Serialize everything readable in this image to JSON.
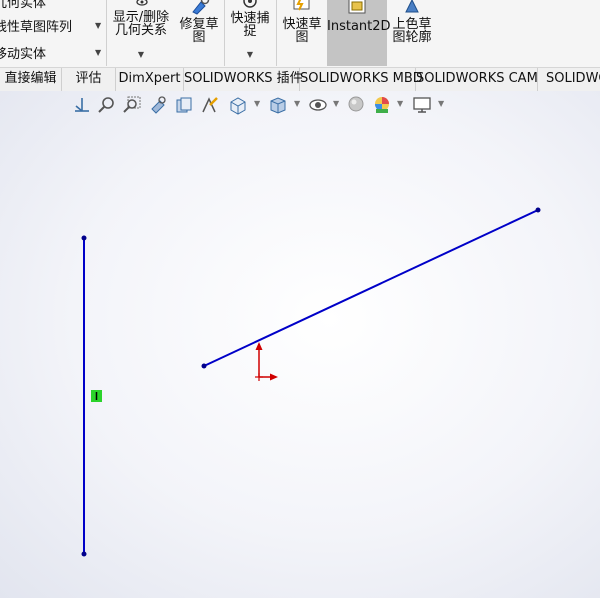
{
  "ribbon": {
    "list_items": [
      {
        "label": "线性草图阵列"
      },
      {
        "label": "移动实体"
      }
    ],
    "top_partial": "几何实体",
    "buttons": {
      "display_delete": {
        "line1": "显示/删除",
        "line2": "几何关系"
      },
      "repair": {
        "line1": "修复草",
        "line2": "图"
      },
      "quick_snap": {
        "line1": "快速捕",
        "line2": "捉"
      },
      "quick_sketch": {
        "line1": "快速草",
        "line2": "图"
      },
      "instant2d": {
        "line1": "Instant2D"
      },
      "shaded_sketch": {
        "line1": "上色草",
        "line2": "图轮廓"
      }
    }
  },
  "tabs": [
    "直接编辑",
    "评估",
    "DimXpert",
    "SOLIDWORKS 插件",
    "SOLIDWORKS MBD",
    "SOLIDWORKS CAM",
    "SOLIDWO"
  ],
  "heads_up_toolbar": {
    "icons": [
      "view-orientation-icon",
      "zoom-to-fit-icon",
      "zoom-to-area-icon",
      "previous-view-icon",
      "section-view-icon",
      "dynamic-annotation-icon",
      "view-orientation-cube-icon",
      "display-style-icon",
      "hide-show-items-icon",
      "edit-appearance-icon",
      "apply-scene-icon",
      "view-settings-icon"
    ]
  },
  "colors": {
    "sketch_line": "#0000c8",
    "endpoint": "#00008c",
    "origin": "#d00000",
    "marker": "#2bd32b",
    "active_button": "#c4c4c4"
  }
}
